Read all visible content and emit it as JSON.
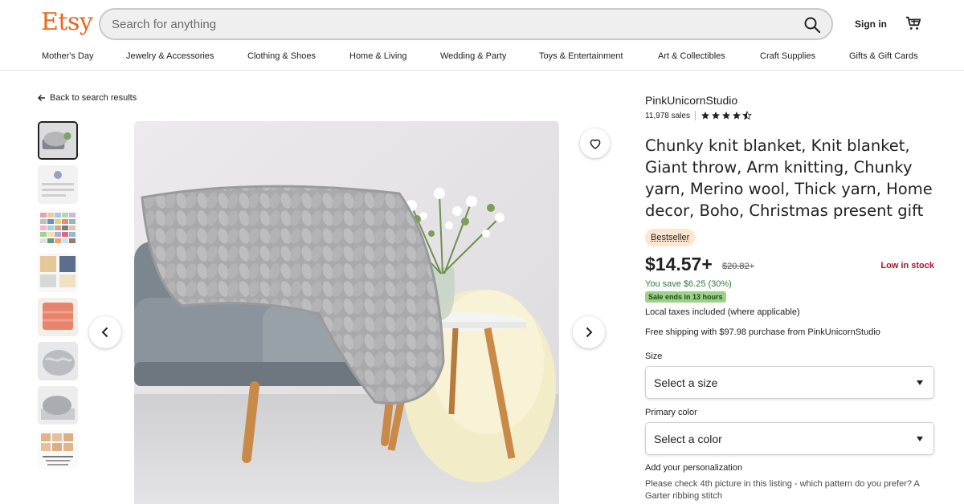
{
  "header": {
    "logo": "Etsy",
    "search_placeholder": "Search for anything",
    "signin": "Sign in"
  },
  "nav": {
    "items": [
      "Mother's Day",
      "Jewelry & Accessories",
      "Clothing & Shoes",
      "Home & Living",
      "Wedding & Party",
      "Toys & Entertainment",
      "Art & Collectibles",
      "Craft Supplies",
      "Gifts & Gift Cards"
    ]
  },
  "gallery": {
    "back": "Back to search results",
    "thumbnail_count": 8
  },
  "shop": {
    "name": "PinkUnicornStudio",
    "sales": "11,978 sales",
    "rating": 4.5
  },
  "listing": {
    "title": "Chunky knit blanket, Knit blanket, Giant throw, Arm knitting, Chunky yarn, Merino wool, Thick yarn, Home decor, Boho, Christmas present gift",
    "badge": "Bestseller",
    "price": "$14.57+",
    "old_price": "$20.82+",
    "stock": "Low in stock",
    "savings": "You save $6.25 (30%)",
    "sale_ends": "Sale ends in 13 hours",
    "taxes": "Local taxes included (where applicable)",
    "shipping": "Free shipping with $97.98 purchase from PinkUnicornStudio"
  },
  "options": {
    "size_label": "Size",
    "size_value": "Select a size",
    "color_label": "Primary color",
    "color_value": "Select a color"
  },
  "personalization": {
    "label": "Add your personalization",
    "description": "Please check 4th picture in this listing - which pattern do you prefer? A Garter ribbing stitch"
  },
  "colors": {
    "brand": "#f1641e",
    "low_stock": "#b3122d",
    "savings": "#2f7a3a",
    "sale_badge": "#9dd08a",
    "bestseller_badge": "#fde6cf"
  }
}
